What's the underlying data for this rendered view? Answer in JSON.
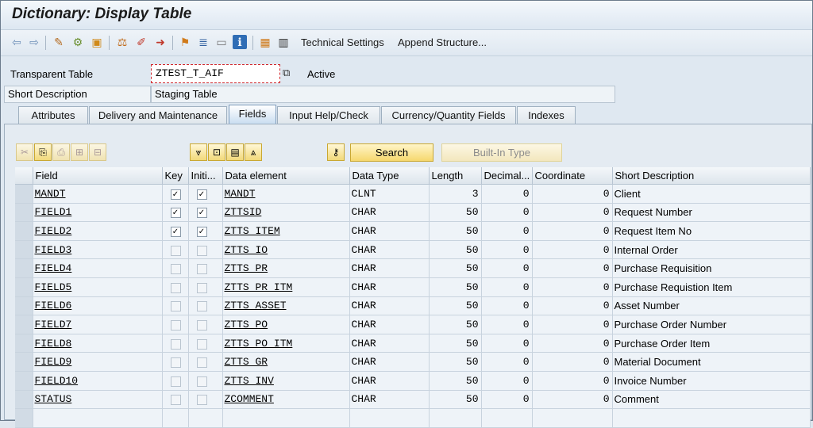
{
  "window": {
    "title": "Dictionary: Display Table"
  },
  "toolbar": {
    "buttons": [
      {
        "name": "back-arrow-icon",
        "glyph": "⇦"
      },
      {
        "name": "forward-arrow-icon",
        "glyph": "⇨"
      },
      {
        "name": "other-object-icon",
        "glyph": "✎"
      },
      {
        "name": "display-change-icon",
        "glyph": "⚙"
      },
      {
        "name": "active-inactive-icon",
        "glyph": "▣"
      },
      {
        "name": "check-icon",
        "glyph": "⚖"
      },
      {
        "name": "activate-icon",
        "glyph": "✐"
      },
      {
        "name": "test-icon",
        "glyph": "➜"
      },
      {
        "name": "hierarchy-icon",
        "glyph": "⚑"
      },
      {
        "name": "where-used-icon",
        "glyph": "≣"
      },
      {
        "name": "layout-icon",
        "glyph": "▭"
      },
      {
        "name": "info-icon",
        "glyph": "ℹ"
      },
      {
        "name": "contents-icon",
        "glyph": "▦"
      },
      {
        "name": "table-view-icon",
        "glyph": "▥"
      }
    ],
    "technical_settings": "Technical Settings",
    "append_structure": "Append Structure..."
  },
  "header": {
    "transparent_table_label": "Transparent Table",
    "transparent_table_value": "ZTEST_T_AIF",
    "status": "Active",
    "short_description_label": "Short Description",
    "short_description_value": "Staging Table"
  },
  "tabs": [
    {
      "label": "Attributes",
      "active": false
    },
    {
      "label": "Delivery and Maintenance",
      "active": false
    },
    {
      "label": "Fields",
      "active": true
    },
    {
      "label": "Input Help/Check",
      "active": false
    },
    {
      "label": "Currency/Quantity Fields",
      "active": false
    },
    {
      "label": "Indexes",
      "active": false
    }
  ],
  "fields_toolbar": {
    "search": "Search",
    "builtin_type": "Built-In Type"
  },
  "grid": {
    "columns": [
      "Field",
      "Key",
      "Initi...",
      "Data element",
      "Data Type",
      "Length",
      "Decimal...",
      "Coordinate",
      "Short Description"
    ],
    "rows": [
      {
        "field": "MANDT",
        "key": true,
        "init": true,
        "element": "MANDT",
        "type": "CLNT",
        "length": "3",
        "decimals": "0",
        "coord": "0",
        "desc": "Client"
      },
      {
        "field": "FIELD1",
        "key": true,
        "init": true,
        "element": "ZTTSID",
        "type": "CHAR",
        "length": "50",
        "decimals": "0",
        "coord": "0",
        "desc": "Request Number"
      },
      {
        "field": "FIELD2",
        "key": true,
        "init": true,
        "element": "ZTTS_ITEM",
        "type": "CHAR",
        "length": "50",
        "decimals": "0",
        "coord": "0",
        "desc": "Request Item No"
      },
      {
        "field": "FIELD3",
        "key": false,
        "init": false,
        "element": "ZTTS_IO",
        "type": "CHAR",
        "length": "50",
        "decimals": "0",
        "coord": "0",
        "desc": "Internal Order"
      },
      {
        "field": "FIELD4",
        "key": false,
        "init": false,
        "element": "ZTTS_PR",
        "type": "CHAR",
        "length": "50",
        "decimals": "0",
        "coord": "0",
        "desc": "Purchase Requisition"
      },
      {
        "field": "FIELD5",
        "key": false,
        "init": false,
        "element": "ZTTS_PR_ITM",
        "type": "CHAR",
        "length": "50",
        "decimals": "0",
        "coord": "0",
        "desc": "Purchase Requistion Item"
      },
      {
        "field": "FIELD6",
        "key": false,
        "init": false,
        "element": "ZTTS_ASSET",
        "type": "CHAR",
        "length": "50",
        "decimals": "0",
        "coord": "0",
        "desc": "Asset Number"
      },
      {
        "field": "FIELD7",
        "key": false,
        "init": false,
        "element": "ZTTS_PO",
        "type": "CHAR",
        "length": "50",
        "decimals": "0",
        "coord": "0",
        "desc": "Purchase Order Number"
      },
      {
        "field": "FIELD8",
        "key": false,
        "init": false,
        "element": "ZTTS_PO_ITM",
        "type": "CHAR",
        "length": "50",
        "decimals": "0",
        "coord": "0",
        "desc": "Purchase Order Item"
      },
      {
        "field": "FIELD9",
        "key": false,
        "init": false,
        "element": "ZTTS_GR",
        "type": "CHAR",
        "length": "50",
        "decimals": "0",
        "coord": "0",
        "desc": "Material Document"
      },
      {
        "field": "FIELD10",
        "key": false,
        "init": false,
        "element": "ZTTS_INV",
        "type": "CHAR",
        "length": "50",
        "decimals": "0",
        "coord": "0",
        "desc": "Invoice Number"
      },
      {
        "field": "STATUS",
        "key": false,
        "init": false,
        "element": "ZCOMMENT",
        "type": "CHAR",
        "length": "50",
        "decimals": "0",
        "coord": "0",
        "desc": "Comment"
      }
    ]
  }
}
